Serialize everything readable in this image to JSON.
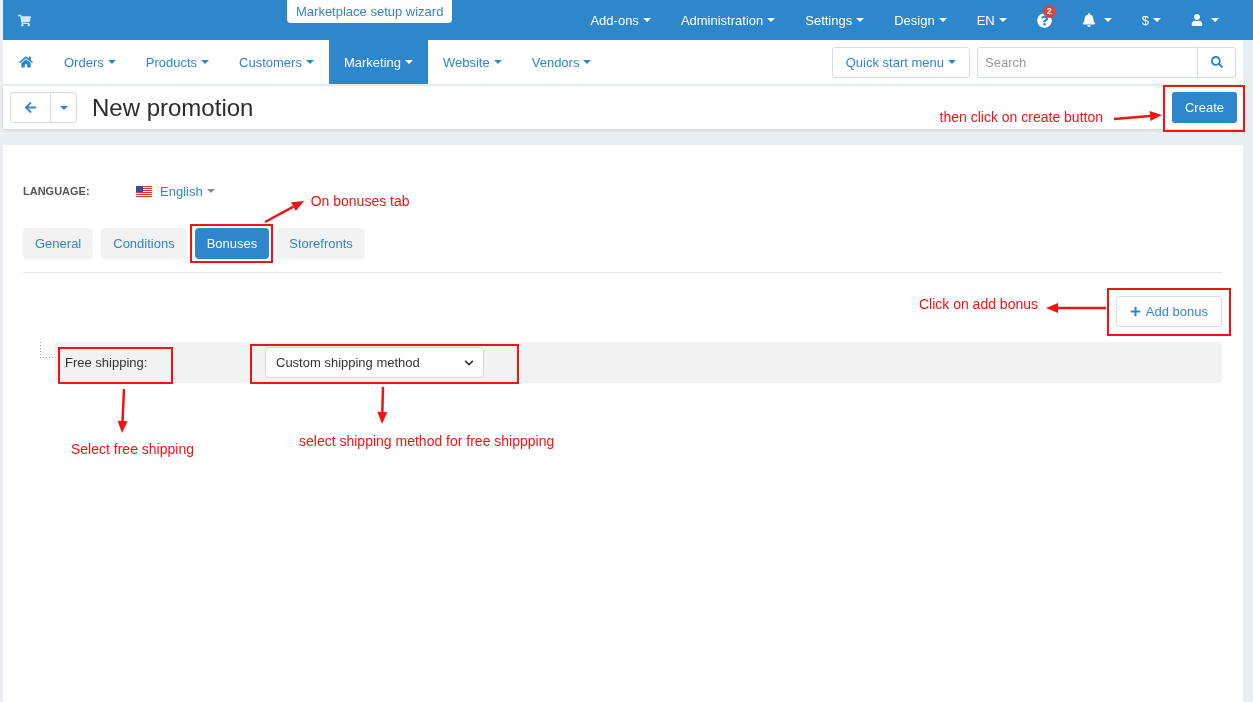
{
  "top_bar": {
    "wizard_tab": "Marketplace setup wizard",
    "menus": [
      {
        "kind": "text",
        "label": "Add-ons",
        "dropdown": true
      },
      {
        "kind": "text",
        "label": "Administration",
        "dropdown": true
      },
      {
        "kind": "text",
        "label": "Settings",
        "dropdown": true
      },
      {
        "kind": "text",
        "label": "Design",
        "dropdown": true
      },
      {
        "kind": "text",
        "label": "EN",
        "dropdown": true
      },
      {
        "kind": "help",
        "badge": "2",
        "dropdown": false
      },
      {
        "kind": "bell",
        "dropdown": true
      },
      {
        "kind": "text",
        "label": "$",
        "dropdown": true
      },
      {
        "kind": "user",
        "dropdown": true
      }
    ]
  },
  "nav": {
    "items": [
      {
        "kind": "home",
        "selected": false
      },
      {
        "kind": "menu",
        "label": "Orders",
        "selected": false
      },
      {
        "kind": "menu",
        "label": "Products",
        "selected": false
      },
      {
        "kind": "menu",
        "label": "Customers",
        "selected": false
      },
      {
        "kind": "menu",
        "label": "Marketing",
        "selected": true
      },
      {
        "kind": "menu",
        "label": "Website",
        "selected": false
      },
      {
        "kind": "menu",
        "label": "Vendors",
        "selected": false
      }
    ],
    "quick_start": "Quick start menu",
    "search": {
      "placeholder": "Search"
    }
  },
  "header": {
    "title": "New promotion",
    "create_button": "Create"
  },
  "form": {
    "language": {
      "label": "LANGUAGE:",
      "value": "English"
    },
    "tabs": [
      {
        "label": "General",
        "selected": false
      },
      {
        "label": "Conditions",
        "selected": false
      },
      {
        "label": "Bonuses",
        "selected": true
      },
      {
        "label": "Storefronts",
        "selected": false
      }
    ],
    "add_bonus": "Add bonus",
    "bonuses": [
      {
        "label": "Free shipping:",
        "value": "Custom shipping method"
      }
    ]
  },
  "annotations": [
    {
      "kind": "create",
      "text": "then click on create button"
    },
    {
      "kind": "tab",
      "text": "On bonuses tab"
    },
    {
      "kind": "add",
      "text": "Click on add bonus"
    },
    {
      "kind": "label",
      "text": "Select free shipping"
    },
    {
      "kind": "select",
      "text": "select shipping method for free shippping"
    }
  ]
}
